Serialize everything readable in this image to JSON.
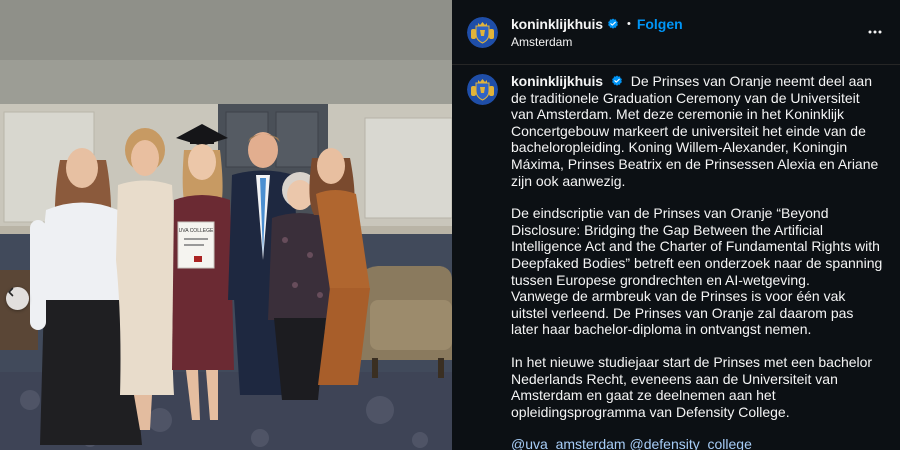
{
  "header": {
    "username": "koninklijkhuis",
    "dot": "•",
    "follow_label": "Folgen",
    "location": "Amsterdam",
    "more_icon": "more-horizontal-icon"
  },
  "photo": {
    "diploma_heading": "UVA COLLEGE",
    "nav_prev_icon": "chevron-left-icon"
  },
  "caption": {
    "username": "koninklijkhuis",
    "paragraphs": [
      "De Prinses van Oranje neemt deel aan de traditionele Graduation Ceremony van de Universiteit van Amsterdam. Met deze ceremonie in het Koninklijk Concertgebouw markeert de universiteit het einde van de bacheloropleiding. Koning Willem-Alexander, Koningin Máxima, Prinses Beatrix en de Prinsessen Alexia en Ariane zijn ook aanwezig.",
      "De eindscriptie van de Prinses van Oranje “Beyond Disclosure: Bridging the Gap Between the Artificial Intelligence Act and the Charter of Fundamental Rights with Deepfaked Bodies” betreft een onderzoek naar de spanning tussen Europese grondrechten en AI-wetgeving.",
      "Vanwege de armbreuk van de Prinses is voor één vak uitstel verleend. De Prinses van Oranje zal daarom pas later haar bachelor-diploma in ontvangst nemen.",
      "In het nieuwe studiejaar start de Prinses met een bachelor Nederlands Recht, eveneens aan de Universiteit van Amsterdam en gaat ze deelnemen aan het opleidingsprogramma van Defensity College."
    ],
    "mentions": [
      "@uva_amsterdam",
      "@defensity_college"
    ]
  },
  "colors": {
    "panel_bg": "#0c1014",
    "accent_blue": "#0095f6",
    "verified_blue": "#0095f6",
    "mention_blue": "#a7cdf7"
  }
}
